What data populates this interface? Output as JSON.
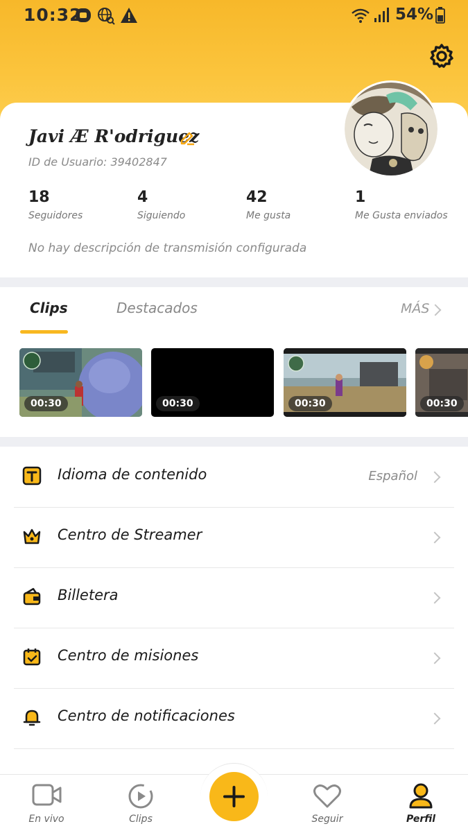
{
  "status_bar": {
    "time": "10:32",
    "battery": "54%"
  },
  "profile": {
    "name": "Javi Æ R'odriguez",
    "user_id": "ID de Usuario: 39402847",
    "stats": [
      {
        "value": "18",
        "label": "Seguidores"
      },
      {
        "value": "4",
        "label": "Siguiendo"
      },
      {
        "value": "42",
        "label": "Me gusta"
      },
      {
        "value": "1",
        "label": "Me Gusta enviados"
      }
    ],
    "description": "No hay descripción de transmisión configurada"
  },
  "tabs": {
    "active": "Clips",
    "inactive": "Destacados",
    "more": "MÁS"
  },
  "clips": [
    {
      "duration": "00:30"
    },
    {
      "duration": "00:30"
    },
    {
      "duration": "00:30"
    },
    {
      "duration": "00:30"
    }
  ],
  "menu": [
    {
      "label": "Idioma de contenido",
      "value": "Español",
      "icon": "translate-icon"
    },
    {
      "label": "Centro de Streamer",
      "value": "",
      "icon": "crown-icon"
    },
    {
      "label": "Billetera",
      "value": "",
      "icon": "wallet-icon"
    },
    {
      "label": "Centro de misiones",
      "value": "",
      "icon": "calendar-check-icon"
    },
    {
      "label": "Centro de notificaciones",
      "value": "",
      "icon": "bell-icon"
    }
  ],
  "bottom_nav": [
    {
      "label": "En vivo",
      "icon": "live-camera-icon"
    },
    {
      "label": "Clips",
      "icon": "clips-play-icon"
    },
    {
      "label": "Seguir",
      "icon": "heart-icon"
    },
    {
      "label": "Perfil",
      "icon": "profile-icon"
    }
  ],
  "colors": {
    "accent": "#f9b819",
    "header": "#fbc43c"
  }
}
